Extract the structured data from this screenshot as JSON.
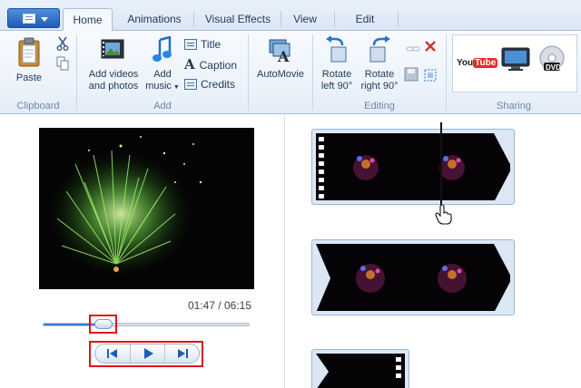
{
  "tabs": [
    {
      "label": "Home",
      "active": true
    },
    {
      "label": "Animations",
      "active": false
    },
    {
      "label": "Visual Effects",
      "active": false
    },
    {
      "label": "View",
      "active": false
    },
    {
      "label": "Edit",
      "active": false
    }
  ],
  "ribbon": {
    "clipboard": {
      "paste": "Paste",
      "group": "Clipboard"
    },
    "add": {
      "add_videos": "Add videos",
      "and_photos": "and photos",
      "add_music_1": "Add",
      "add_music_2": "music",
      "title": "Title",
      "caption": "Caption",
      "credits": "Credits",
      "group": "Add"
    },
    "automovie": {
      "label": "AutoMovie"
    },
    "editing": {
      "rotate_left_1": "Rotate",
      "rotate_left_2": "left 90°",
      "rotate_right_1": "Rotate",
      "rotate_right_2": "right 90°",
      "group": "Editing"
    },
    "sharing": {
      "youtube": "YouTube",
      "dvd": "DVD",
      "group": "Sharing"
    }
  },
  "preview": {
    "timecode": "01:47 / 06:15",
    "seek_progress": 0.26
  },
  "colors": {
    "accent": "#3a7bd5",
    "highlight": "#e0141a",
    "ribbon_text": "#1e395b",
    "youtube_red": "#e52d27"
  }
}
